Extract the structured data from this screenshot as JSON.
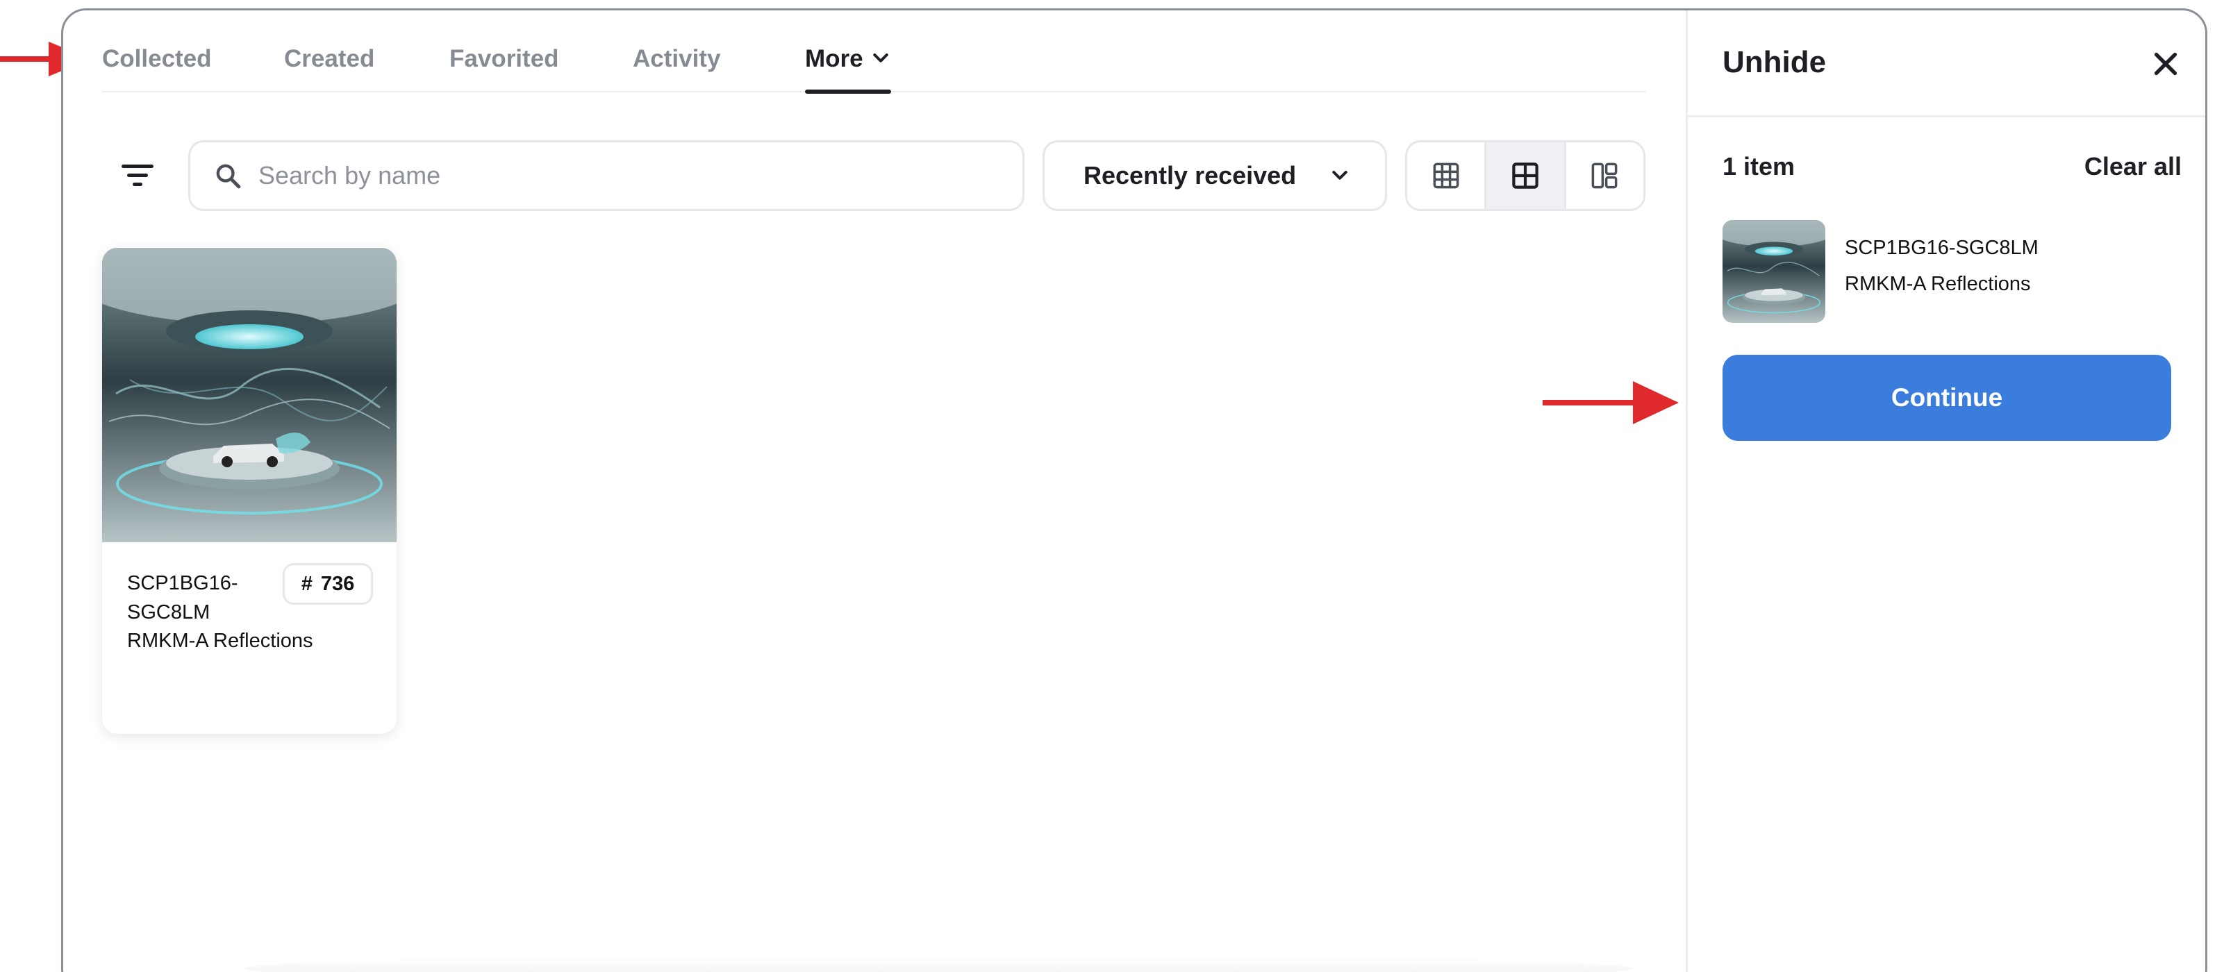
{
  "tabs": [
    {
      "label": "Collected"
    },
    {
      "label": "Created"
    },
    {
      "label": "Favorited"
    },
    {
      "label": "Activity"
    },
    {
      "label": "More"
    }
  ],
  "active_tab": "More",
  "toolbar": {
    "search_placeholder": "Search by name",
    "search_value": "",
    "sort_label": "Recently received",
    "view_modes": [
      "grid-small",
      "grid-large",
      "grid-mixed"
    ],
    "active_view": "grid-large"
  },
  "card": {
    "name_line1": "SCP1BG16-",
    "name_line2": "SGC8LM",
    "badge_symbol": "#",
    "badge_number": "736",
    "collection": "RMKM-A Reflections"
  },
  "panel": {
    "title": "Unhide",
    "count": "1 item",
    "clear_label": "Clear all",
    "item": {
      "name": "SCP1BG16-SGC8LM",
      "collection": "RMKM-A Reflections"
    },
    "continue_label": "Continue"
  },
  "colors": {
    "accent": "#3b7ddd",
    "text_primary": "#1d1f24",
    "text_muted": "#858a93",
    "border": "#e6e7ea",
    "annotation_arrow": "#e0292c"
  }
}
